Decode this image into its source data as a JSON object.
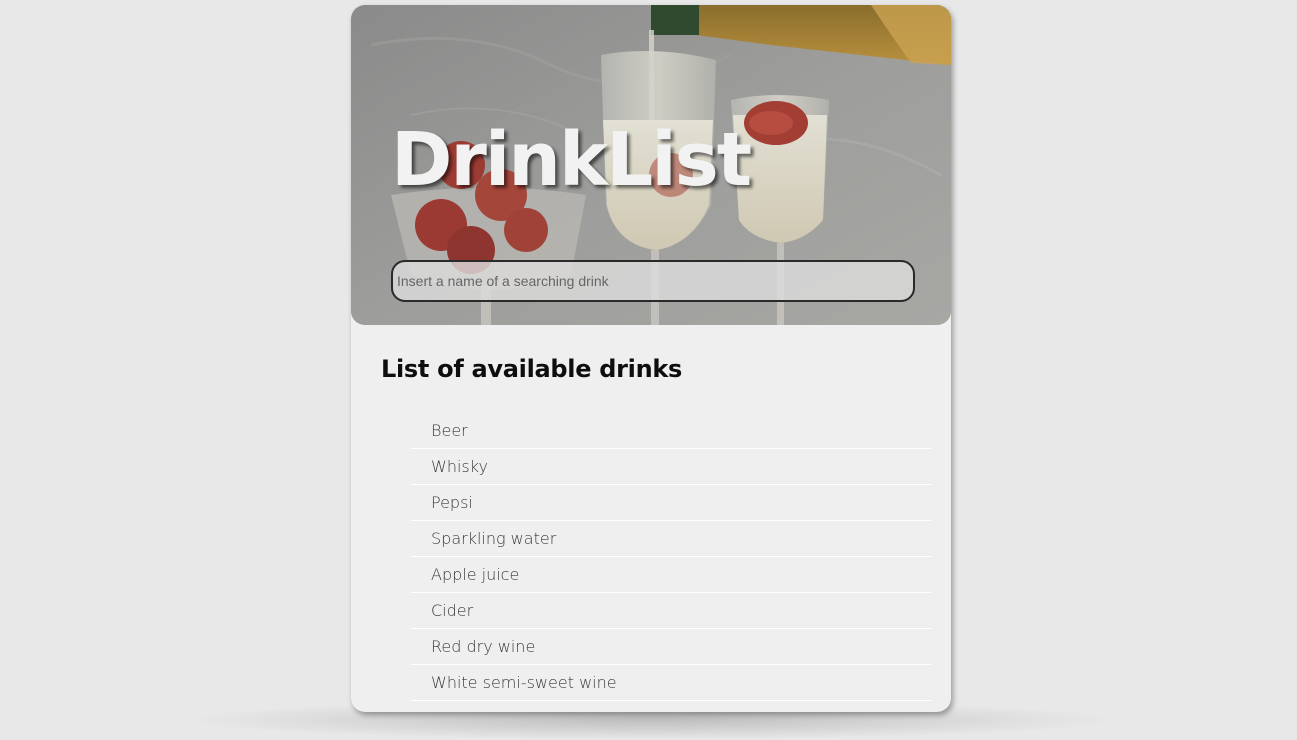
{
  "app": {
    "title": "DrinkList"
  },
  "search": {
    "placeholder": "Insert a name of a searching drink",
    "value": ""
  },
  "list": {
    "heading": "List of available drinks",
    "items": [
      {
        "label": "Beer"
      },
      {
        "label": "Whisky"
      },
      {
        "label": "Pepsi"
      },
      {
        "label": "Sparkling water"
      },
      {
        "label": "Apple juice"
      },
      {
        "label": "Cider"
      },
      {
        "label": "Red dry wine"
      },
      {
        "label": "White semi-sweet wine"
      }
    ]
  },
  "colors": {
    "page_background": "#e8e8e8",
    "card_background": "#efefef",
    "title_text": "#f2f2f2",
    "heading_text": "#0e0e0e",
    "item_text": "#3a3a3a"
  },
  "images": {
    "hero": "champagne-glasses-with-strawberries-photo"
  }
}
